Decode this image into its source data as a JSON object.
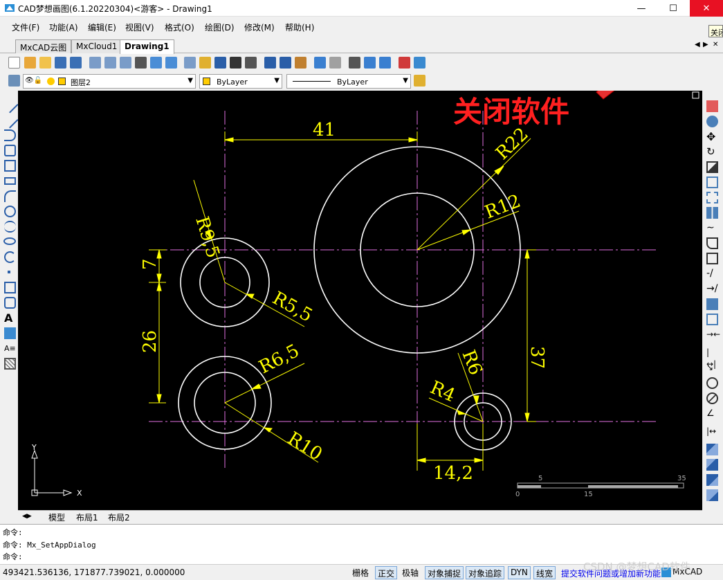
{
  "window": {
    "title": "CAD梦想画图(6.1.20220304)<游客> - Drawing1",
    "minimize": "—",
    "maximize": "☐",
    "close": "✕",
    "tooltip": "关闭"
  },
  "menu": [
    {
      "label": "文件(F)"
    },
    {
      "label": "功能(A)"
    },
    {
      "label": "编辑(E)"
    },
    {
      "label": "视图(V)"
    },
    {
      "label": "格式(O)"
    },
    {
      "label": "绘图(D)"
    },
    {
      "label": "修改(M)"
    },
    {
      "label": "帮助(H)"
    }
  ],
  "tabs": [
    {
      "label": "MxCAD云图"
    },
    {
      "label": "MxCloud1"
    },
    {
      "label": "Drawing1"
    }
  ],
  "tab_nav": [
    "◀",
    "▶",
    "✕"
  ],
  "layer": {
    "name": "图层2",
    "color_label": "ByLayer",
    "linetype_label": "ByLayer"
  },
  "annotation": {
    "text": "关闭软件",
    "color": "#ff2020"
  },
  "dimensions": {
    "d41": "41",
    "d7": "7",
    "d26": "26",
    "d37": "37",
    "d142": "14,2",
    "r95": "R9,5",
    "r55": "R5,5",
    "r65": "R6,5",
    "r10": "R10",
    "r22": "R22",
    "r12": "R12",
    "r6": "R6",
    "r4": "R4"
  },
  "scale_bar": {
    "t5": "5",
    "t35": "35",
    "t0": "0",
    "t15": "15"
  },
  "ucs": {
    "x": "X",
    "y": "Y"
  },
  "layouts": [
    {
      "label": "模型"
    },
    {
      "label": "布局1"
    },
    {
      "label": "布局2"
    }
  ],
  "command_lines": [
    "命令:",
    "命令: Mx_SetAppDialog",
    "命令:"
  ],
  "status": {
    "coords": "493421.536136,  171877.739021,  0.000000",
    "buttons": [
      "栅格",
      "正交",
      "极轴",
      "对象捕捉",
      "对象追踪",
      "DYN",
      "线宽"
    ],
    "feedback": "提交软件问题或增加新功能",
    "brand": "MxCAD",
    "watermark": "CSDN @梦想CAD软件"
  },
  "colors": {
    "dim": "#ffff00",
    "center": "#e070e0",
    "geometry": "#ffffff",
    "accent_close": "#e81123"
  }
}
